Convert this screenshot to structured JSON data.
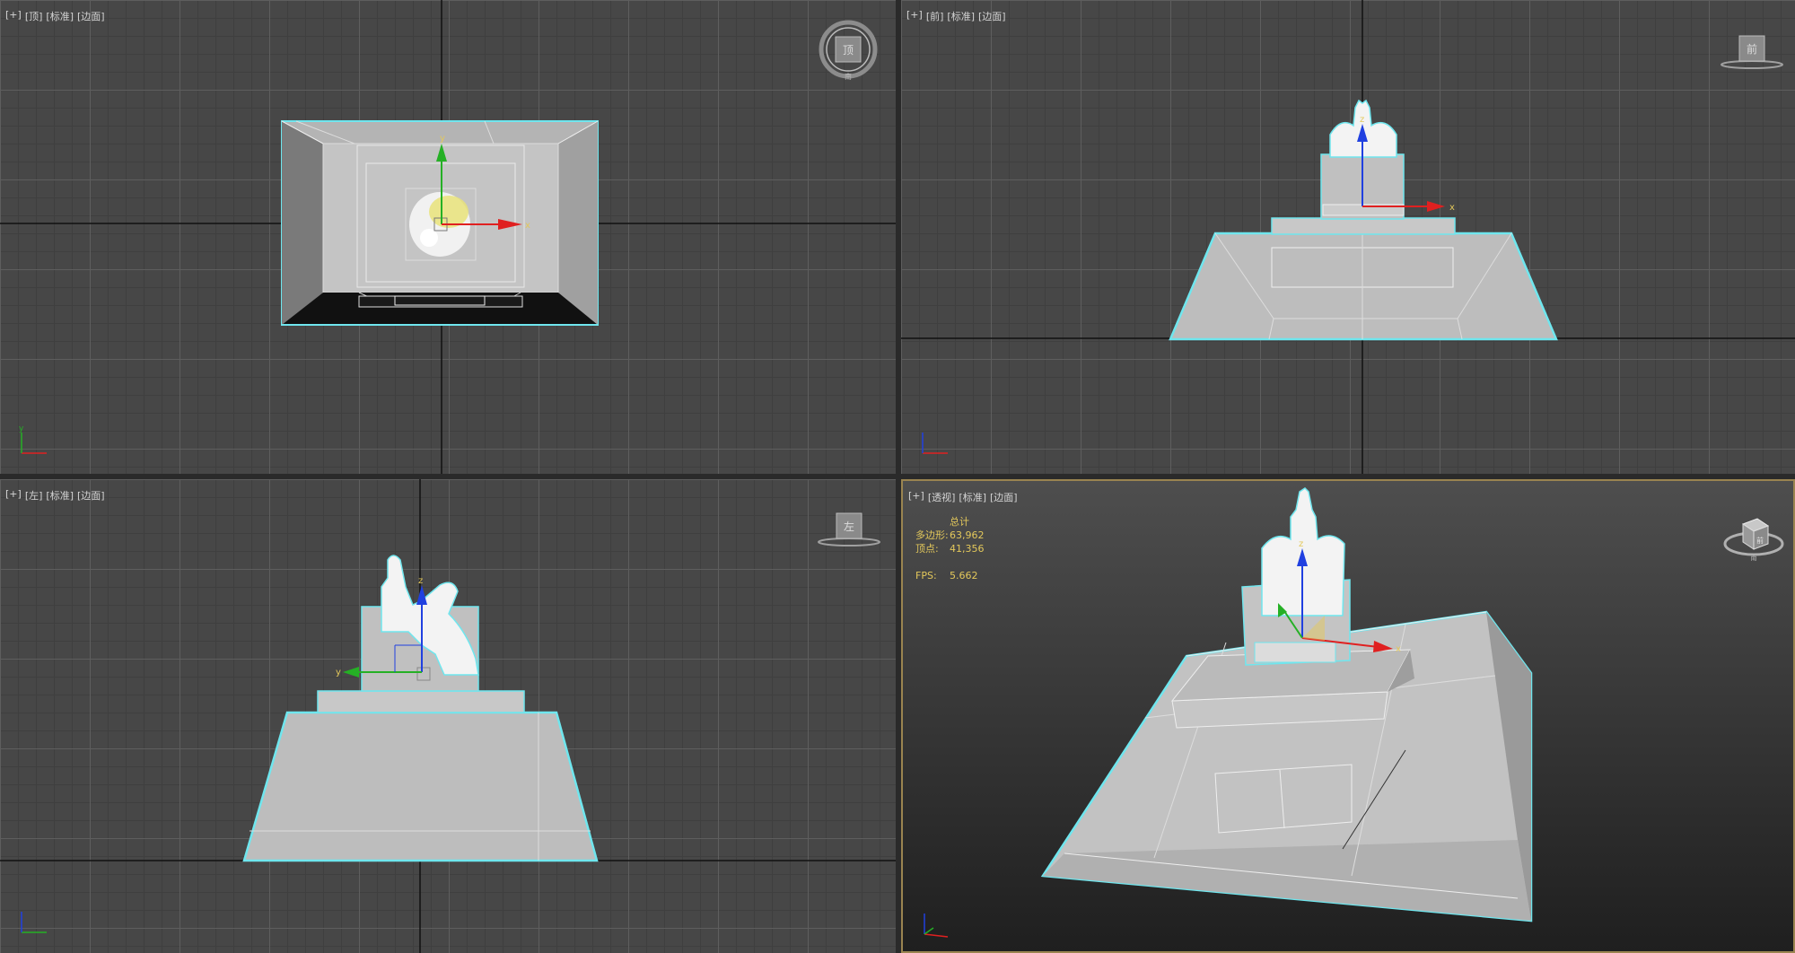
{
  "viewports": {
    "top": {
      "menu": [
        "[+]",
        "[顶]",
        "[标准]",
        "[边面]"
      ]
    },
    "front": {
      "menu": [
        "[+]",
        "[前]",
        "[标准]",
        "[边面]"
      ]
    },
    "left": {
      "menu": [
        "[+]",
        "[左]",
        "[标准]",
        "[边面]"
      ]
    },
    "persp": {
      "menu": [
        "[+]",
        "[透视]",
        "[标准]",
        "[边面]"
      ]
    }
  },
  "stats": {
    "header": "总计",
    "polys_label": "多边形:",
    "polys_value": "63,962",
    "verts_label": "顶点:",
    "verts_value": "41,356",
    "fps_label": "FPS:",
    "fps_value": "5.662"
  },
  "navcube": {
    "top_face": "顶",
    "front_face": "前",
    "left_face": "左",
    "persp_face": "前",
    "compass_south": "南"
  },
  "gizmo_axes": {
    "x": "x",
    "y": "y",
    "z": "z"
  },
  "colors": {
    "selection": "#6fe6ee",
    "x_axis": "#e02020",
    "y_axis": "#25b025",
    "z_axis": "#2040e0",
    "stats_text": "#e3c85b",
    "active_viewport_border": "#9a8450"
  }
}
